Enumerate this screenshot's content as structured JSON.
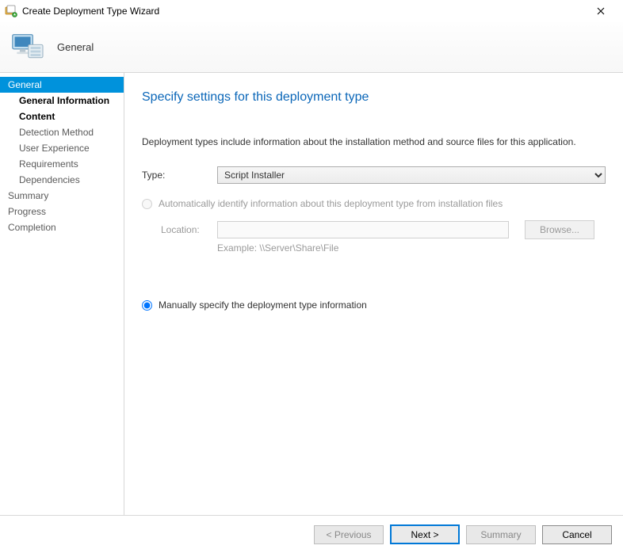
{
  "window": {
    "title": "Create Deployment Type Wizard"
  },
  "header": {
    "page_name": "General"
  },
  "sidebar": {
    "items": [
      {
        "label": "General",
        "level": 0,
        "selected": true
      },
      {
        "label": "General Information",
        "level": 1,
        "bold": true
      },
      {
        "label": "Content",
        "level": 1,
        "bold": true
      },
      {
        "label": "Detection Method",
        "level": 1
      },
      {
        "label": "User Experience",
        "level": 1
      },
      {
        "label": "Requirements",
        "level": 1
      },
      {
        "label": "Dependencies",
        "level": 1
      },
      {
        "label": "Summary",
        "level": 0
      },
      {
        "label": "Progress",
        "level": 0
      },
      {
        "label": "Completion",
        "level": 0
      }
    ]
  },
  "content": {
    "heading": "Specify settings for this deployment type",
    "description": "Deployment types include information about the installation method and source files for this application.",
    "type_label": "Type:",
    "type_value": "Script Installer",
    "radio_auto_label": "Automatically identify information about this deployment type from installation files",
    "location_label": "Location:",
    "location_value": "",
    "browse_label": "Browse...",
    "example_label": "Example: \\\\Server\\Share\\File",
    "radio_manual_label": "Manually specify the deployment type information"
  },
  "footer": {
    "previous": "< Previous",
    "next": "Next >",
    "summary": "Summary",
    "cancel": "Cancel"
  }
}
